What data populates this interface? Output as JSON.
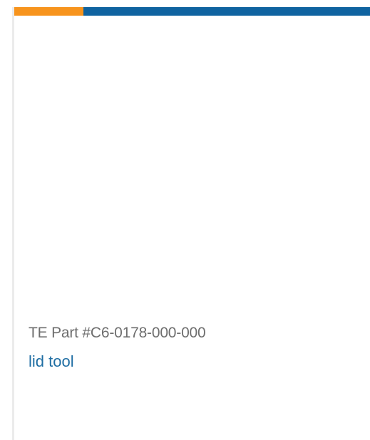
{
  "colors": {
    "accent_orange": "#f7941d",
    "accent_blue": "#0f63a0",
    "part_text": "#6e6e6e",
    "link_text": "#1f6ea3"
  },
  "product": {
    "part_number": "TE Part #C6-0178-000-000",
    "name": "lid tool"
  }
}
